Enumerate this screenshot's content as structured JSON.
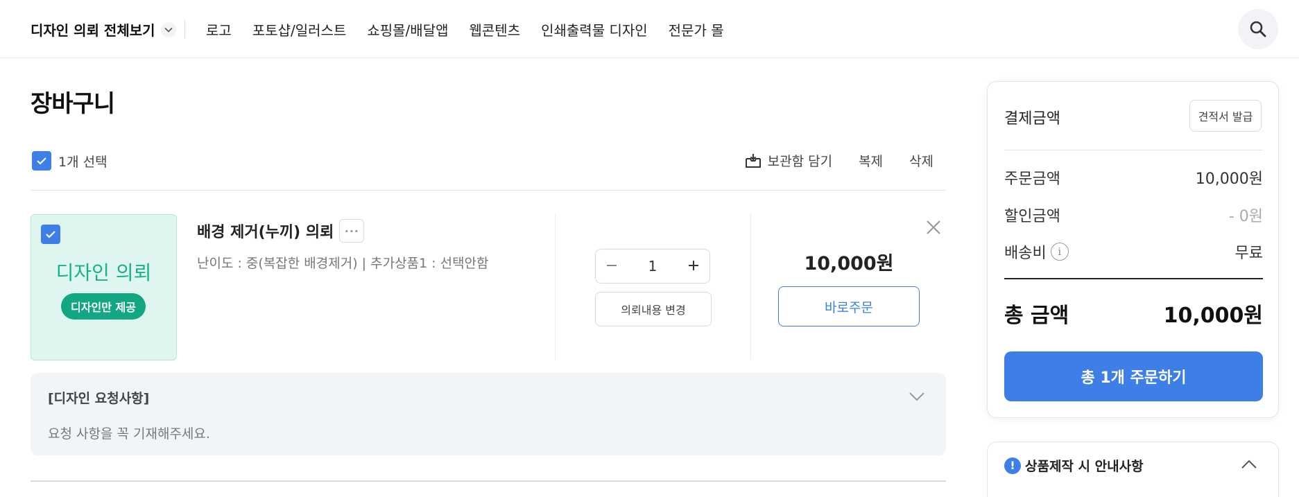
{
  "header": {
    "all_requests": "디자인 의뢰 전체보기",
    "nav": [
      "로고",
      "포토샵/일러스트",
      "쇼핑몰/배달앱",
      "웹콘텐츠",
      "인쇄출력물 디자인",
      "전문가 몰"
    ]
  },
  "cart": {
    "title": "장바구니",
    "selected": "1개 선택",
    "actions": {
      "store": "보관함 담기",
      "copy": "복제",
      "delete": "삭제"
    }
  },
  "item": {
    "thumb_title": "디자인 의뢰",
    "thumb_badge": "디자인만 제공",
    "name": "배경 제거(누끼) 의뢰",
    "more": "···",
    "options": "난이도 : 중(복잡한 배경제거) | 추가상품1 : 선택안함",
    "quantity": "1",
    "edit": "의뢰내용 변경",
    "price": "10,000원",
    "order_now": "바로주문"
  },
  "request": {
    "title": "[디자인 요청사항]",
    "placeholder": "요청 사항을 꼭 기재해주세요."
  },
  "summary": {
    "title": "결제금액",
    "quote": "견적서 발급",
    "order_amount_label": "주문금액",
    "order_amount": "10,000원",
    "discount_label": "할인금액",
    "discount": "- 0원",
    "shipping_label": "배송비",
    "shipping": "무료",
    "total_label": "총 금액",
    "total": "10,000원",
    "checkout": "총 1개 주문하기"
  },
  "notice": {
    "title": "상품제작 시 안내사항"
  },
  "colors": {
    "accent": "#3d7fe6",
    "mint_bg": "#dff5ef",
    "mint_text": "#17b18b",
    "mint_badge": "#12a683"
  },
  "icons": [
    "chevron-down-icon",
    "search-icon",
    "check-icon",
    "archive-icon",
    "close-icon",
    "minus-icon",
    "plus-icon",
    "info-icon",
    "exclamation-icon",
    "chevron-up-icon"
  ]
}
